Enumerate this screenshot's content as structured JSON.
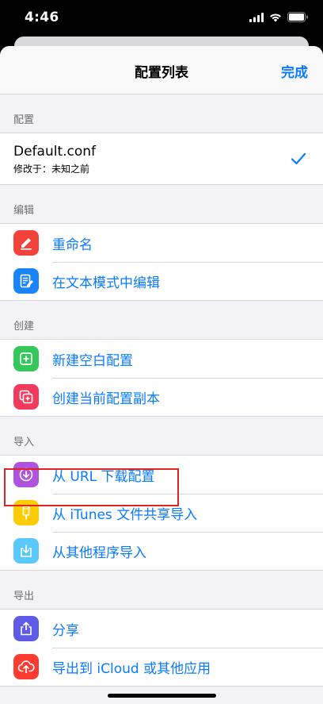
{
  "status_bar": {
    "time": "4:46"
  },
  "navbar": {
    "title": "配置列表",
    "done_label": "完成"
  },
  "sections": {
    "config": {
      "header": "配置",
      "item": {
        "name": "Default.conf",
        "modified": "修改于：未知之前",
        "selected": true
      }
    },
    "edit": {
      "header": "编辑",
      "items": [
        {
          "label": "重命名",
          "icon": "rename-icon",
          "color": "#f2423a"
        },
        {
          "label": "在文本模式中编辑",
          "icon": "text-edit-icon",
          "color": "#1a84ff"
        }
      ]
    },
    "create": {
      "header": "创建",
      "items": [
        {
          "label": "新建空白配置",
          "icon": "new-blank-icon",
          "color": "#34c759"
        },
        {
          "label": "创建当前配置副本",
          "icon": "duplicate-icon",
          "color": "#f23a5c"
        }
      ]
    },
    "import": {
      "header": "导入",
      "items": [
        {
          "label": "从 URL 下载配置",
          "icon": "download-icon",
          "color": "#af52de"
        },
        {
          "label": "从 iTunes 文件共享导入",
          "icon": "usb-icon",
          "color": "#ffcc00"
        },
        {
          "label": "从其他程序导入",
          "icon": "import-icon",
          "color": "#5ac8fa"
        }
      ]
    },
    "export": {
      "header": "导出",
      "items": [
        {
          "label": "分享",
          "icon": "share-icon",
          "color": "#5e5ce6"
        },
        {
          "label": "导出到 iCloud 或其他应用",
          "icon": "cloud-upload-icon",
          "color": "#ff3b30"
        }
      ]
    }
  },
  "colors": {
    "accent": "#0a7aff",
    "highlight_border": "#e02424"
  }
}
